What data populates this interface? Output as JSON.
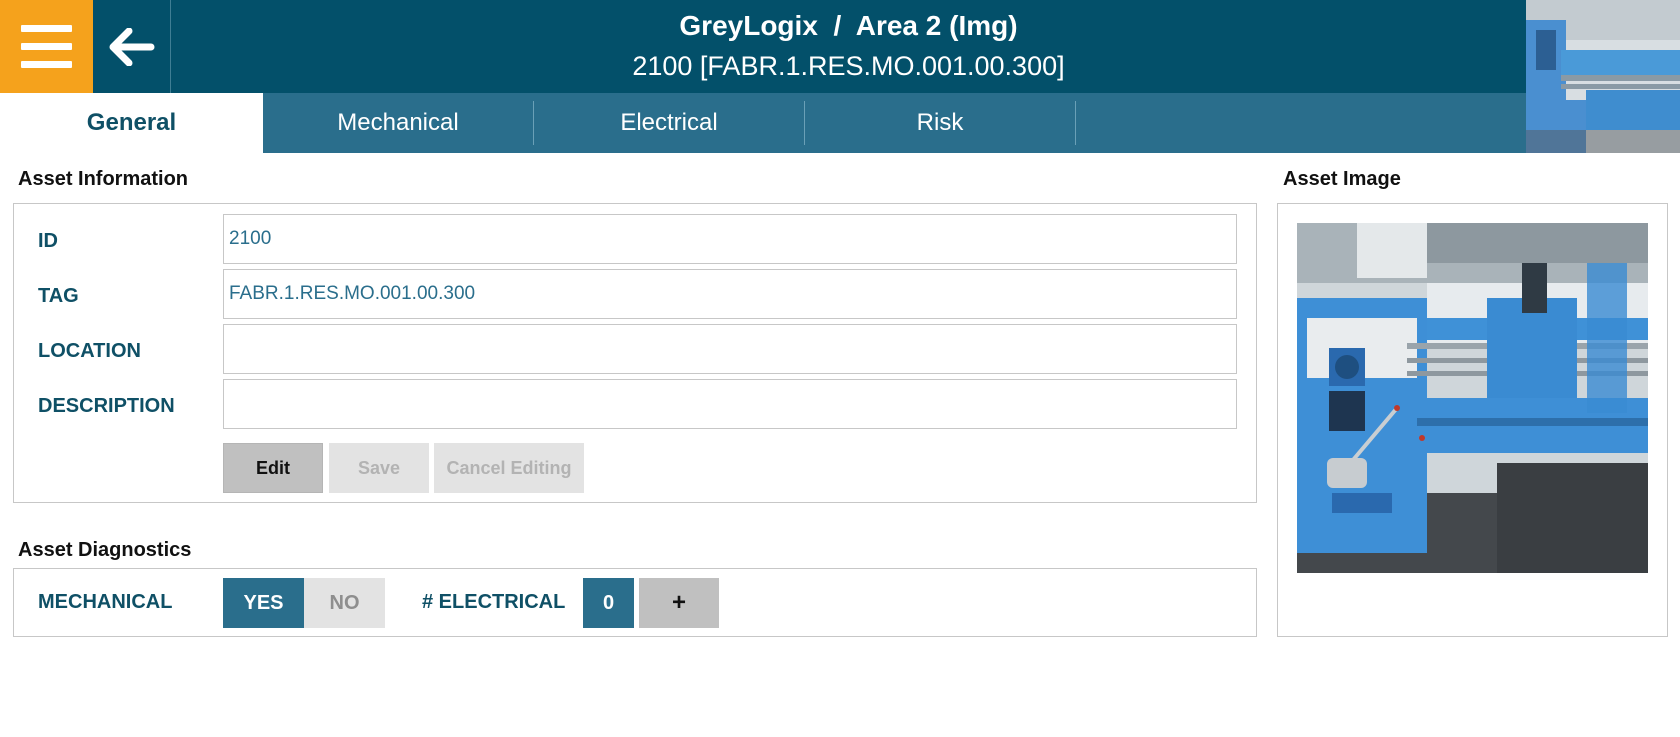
{
  "header": {
    "title": "GreyLogix  /  Area 2 (Img)",
    "subtitle": "2100 [FABR.1.RES.MO.001.00.300]",
    "menu_icon": "hamburger-menu-icon",
    "back_icon": "back-arrow-icon",
    "colors": {
      "bar": "#03506a",
      "menu": "#f5a21c"
    }
  },
  "tabs": [
    {
      "label": "General",
      "active": true
    },
    {
      "label": "Mechanical",
      "active": false
    },
    {
      "label": "Electrical",
      "active": false
    },
    {
      "label": "Risk",
      "active": false
    }
  ],
  "asset_information": {
    "title": "Asset Information",
    "fields": [
      {
        "label": "ID",
        "value": "2100"
      },
      {
        "label": "TAG",
        "value": "FABR.1.RES.MO.001.00.300"
      },
      {
        "label": "LOCATION",
        "value": ""
      },
      {
        "label": "DESCRIPTION",
        "value": ""
      }
    ],
    "buttons": {
      "edit": "Edit",
      "save": "Save",
      "cancel": "Cancel Editing"
    }
  },
  "asset_diagnostics": {
    "title": "Asset Diagnostics",
    "mechanical_label": "MECHANICAL",
    "yes_label": "YES",
    "no_label": "NO",
    "mechanical_selected": "YES",
    "electrical_label": "# ELECTRICAL",
    "electrical_count": "0",
    "add_label": "+"
  },
  "asset_image": {
    "title": "Asset Image",
    "depicts": "lathe-machine-photo"
  }
}
